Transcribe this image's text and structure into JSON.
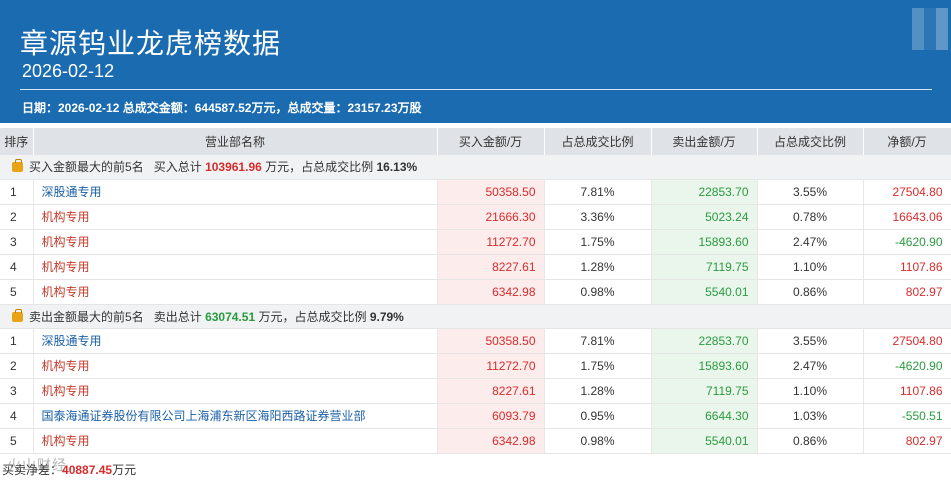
{
  "header": {
    "title": "章源钨业龙虎榜数据",
    "date": "2026-02-12",
    "summary": "日期：2026-02-12 总成交金额：644587.52万元，总成交量：23157.23万股"
  },
  "columns": [
    "排序",
    "营业部名称",
    "买入金额/万",
    "占总成交比例",
    "卖出金额/万",
    "占总成交比例",
    "净额/万"
  ],
  "buy_group": {
    "label": "买入金额最大的前5名",
    "total_label": "买入总计",
    "total_value": "103961.96",
    "unit_text": "万元，占总成交比例",
    "ratio": "16.13%",
    "rows": [
      {
        "rank": "1",
        "name": "深股通专用",
        "buy": "50358.50",
        "buy_ratio": "7.81%",
        "sell": "22853.70",
        "sell_ratio": "3.55%",
        "net": "27504.80"
      },
      {
        "rank": "2",
        "name": "机构专用",
        "buy": "21666.30",
        "buy_ratio": "3.36%",
        "sell": "5023.24",
        "sell_ratio": "0.78%",
        "net": "16643.06"
      },
      {
        "rank": "3",
        "name": "机构专用",
        "buy": "11272.70",
        "buy_ratio": "1.75%",
        "sell": "15893.60",
        "sell_ratio": "2.47%",
        "net": "-4620.90"
      },
      {
        "rank": "4",
        "name": "机构专用",
        "buy": "8227.61",
        "buy_ratio": "1.28%",
        "sell": "7119.75",
        "sell_ratio": "1.10%",
        "net": "1107.86"
      },
      {
        "rank": "5",
        "name": "机构专用",
        "buy": "6342.98",
        "buy_ratio": "0.98%",
        "sell": "5540.01",
        "sell_ratio": "0.86%",
        "net": "802.97"
      }
    ]
  },
  "sell_group": {
    "label": "卖出金额最大的前5名",
    "total_label": "卖出总计",
    "total_value": "63074.51",
    "unit_text": "万元，占总成交比例",
    "ratio": "9.79%",
    "rows": [
      {
        "rank": "1",
        "name": "深股通专用",
        "buy": "50358.50",
        "buy_ratio": "7.81%",
        "sell": "22853.70",
        "sell_ratio": "3.55%",
        "net": "27504.80"
      },
      {
        "rank": "2",
        "name": "机构专用",
        "buy": "11272.70",
        "buy_ratio": "1.75%",
        "sell": "15893.60",
        "sell_ratio": "2.47%",
        "net": "-4620.90"
      },
      {
        "rank": "3",
        "name": "机构专用",
        "buy": "8227.61",
        "buy_ratio": "1.28%",
        "sell": "7119.75",
        "sell_ratio": "1.10%",
        "net": "1107.86"
      },
      {
        "rank": "4",
        "name": "国泰海通证券股份有限公司上海浦东新区海阳西路证券营业部",
        "buy": "6093.79",
        "buy_ratio": "0.95%",
        "sell": "6644.30",
        "sell_ratio": "1.03%",
        "net": "-550.51"
      },
      {
        "rank": "5",
        "name": "机构专用",
        "buy": "6342.98",
        "buy_ratio": "0.98%",
        "sell": "5540.01",
        "sell_ratio": "0.86%",
        "net": "802.97"
      }
    ]
  },
  "footer": {
    "label": "买卖净差：",
    "value": "40887.45",
    "unit": "万元",
    "watermark": "火山财经"
  },
  "colors": {
    "header_bg": "#1a6bb0",
    "buy": "#d82c2c",
    "sell": "#2a9a3e",
    "link_blue": "#1a5fa8"
  }
}
